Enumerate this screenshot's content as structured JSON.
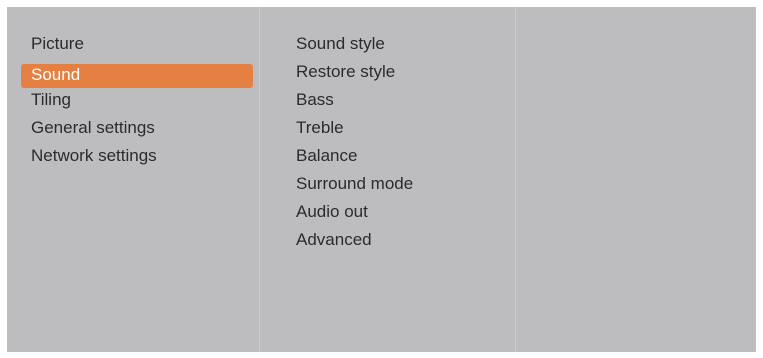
{
  "main_menu": {
    "items": [
      {
        "label": "Picture"
      },
      {
        "label": "Sound",
        "selected": true
      },
      {
        "label": "Tiling"
      },
      {
        "label": "General settings"
      },
      {
        "label": "Network settings"
      }
    ]
  },
  "sub_menu": {
    "items": [
      {
        "label": "Sound style"
      },
      {
        "label": "Restore style"
      },
      {
        "label": "Bass"
      },
      {
        "label": "Treble"
      },
      {
        "label": "Balance"
      },
      {
        "label": "Surround mode"
      },
      {
        "label": "Audio out"
      },
      {
        "label": "Advanced"
      }
    ]
  },
  "colors": {
    "panel_background": "#bdbdbf",
    "selection_highlight": "#e57f42",
    "text": "#2b2b2b",
    "selected_text": "#ffffff"
  }
}
